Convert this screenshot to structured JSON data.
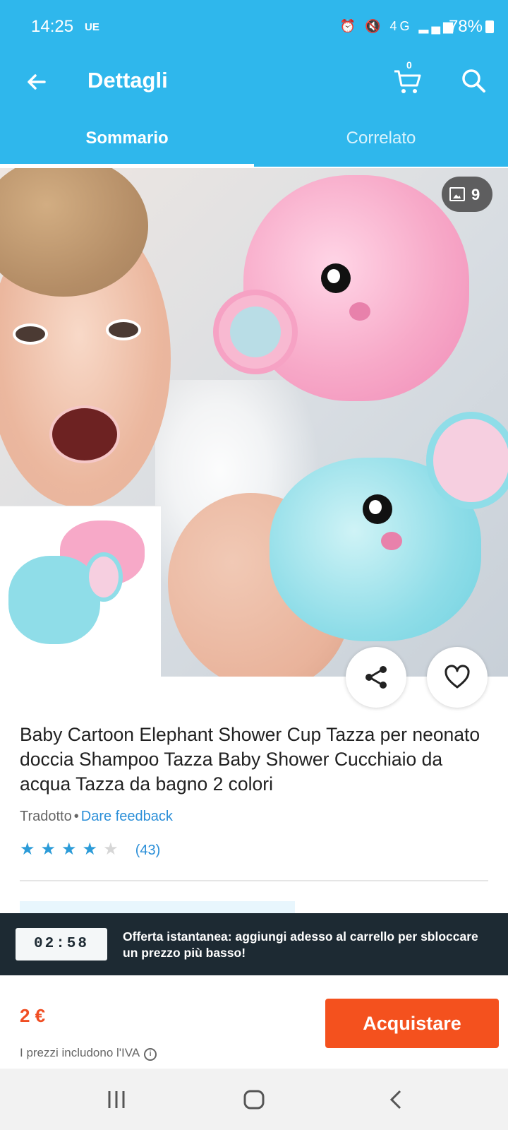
{
  "status_bar": {
    "time": "14:25",
    "carrier_badge": "UE",
    "battery": "78%",
    "network_icon": "4G"
  },
  "app_bar": {
    "title": "Dettagli",
    "cart_count": "0"
  },
  "tabs": [
    {
      "label": "Sommario",
      "active": true
    },
    {
      "label": "Correlato",
      "active": false
    }
  ],
  "gallery": {
    "image_count": "9"
  },
  "product": {
    "title": "Baby Cartoon Elephant Shower Cup Tazza per neonato doccia Shampoo Tazza Baby Shower Cucchiaio da acqua Tazza da bagno 2 colori",
    "translated_label": "Tradotto",
    "separator": "•",
    "feedback_link": "Dare feedback",
    "rating": 4,
    "rating_max": 5,
    "review_count": "(43)"
  },
  "offer": {
    "timer": "02:58",
    "text": "Offerta istantanea: aggiungi adesso al carrello per sbloccare un prezzo più basso!"
  },
  "purchase": {
    "price": "2 €",
    "vat_note": "I prezzi includono l'IVA",
    "buy_label": "Acquistare"
  },
  "colors": {
    "primary": "#2fb7ec",
    "accent": "#f4511e",
    "price": "#f04e23",
    "banner": "#1d2a33"
  }
}
